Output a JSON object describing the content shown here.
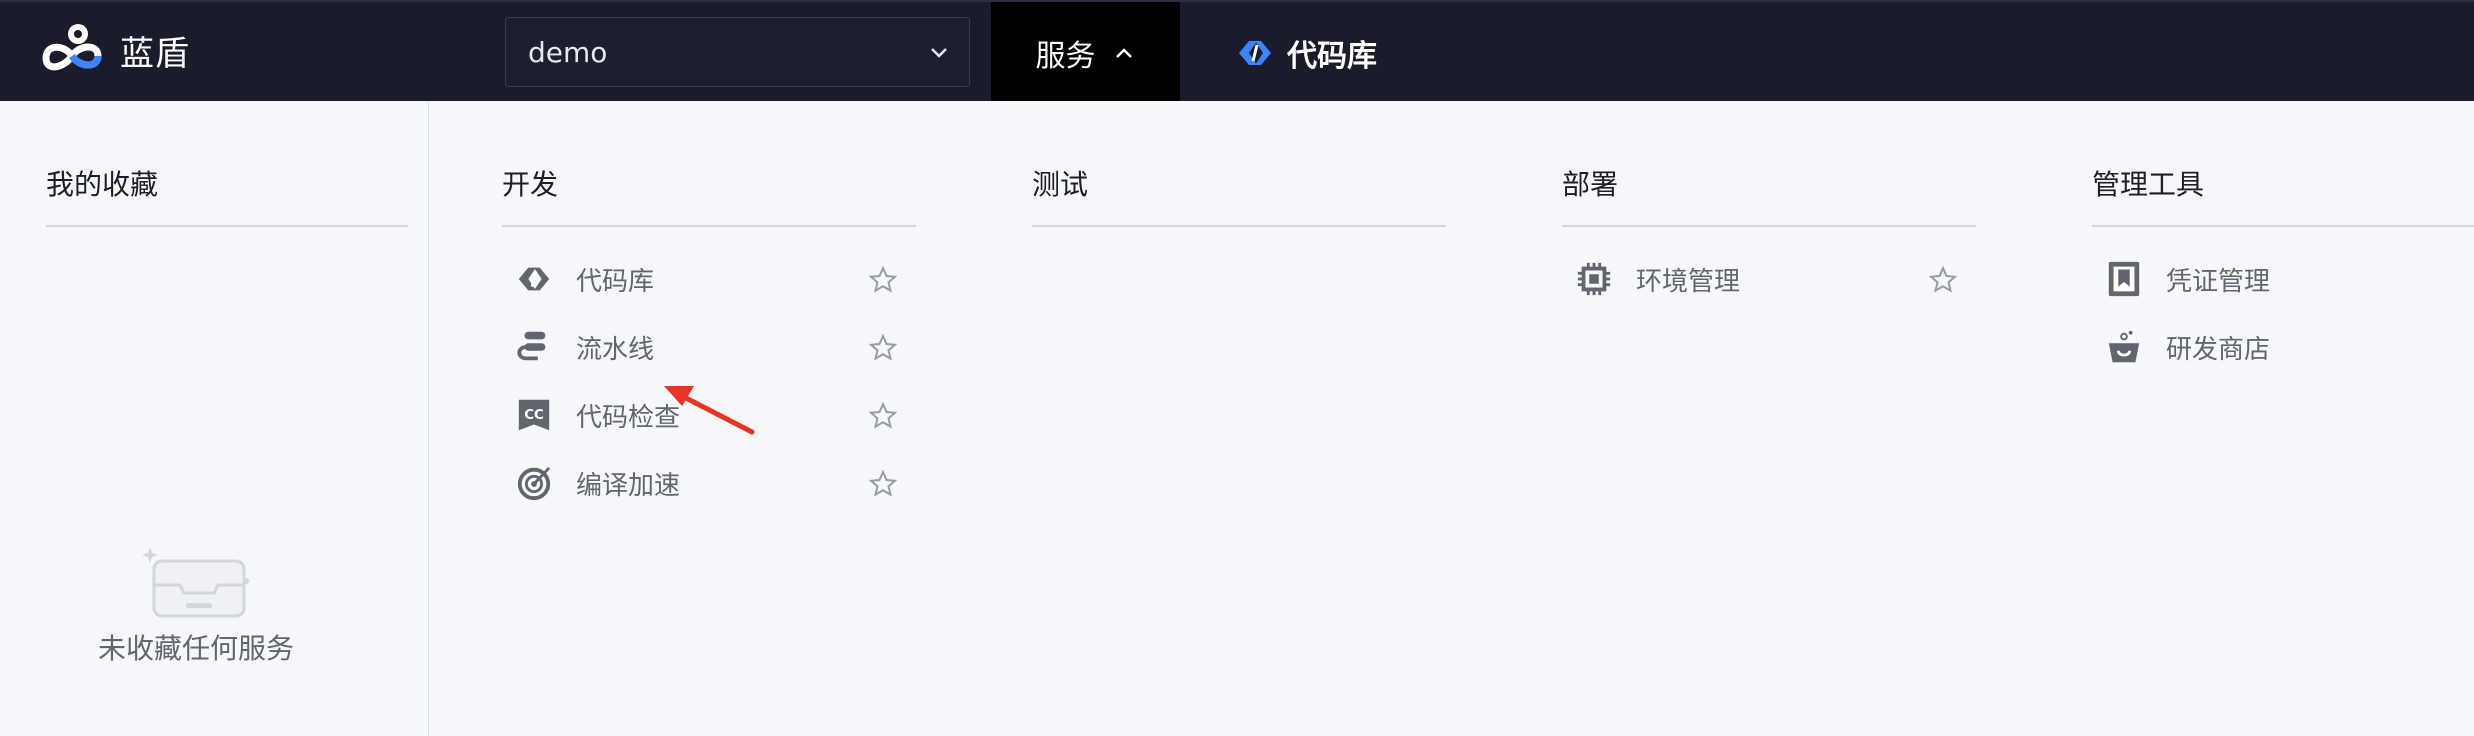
{
  "brand": {
    "name": "蓝盾"
  },
  "project": {
    "value": "demo"
  },
  "nav": {
    "services_label": "服务",
    "current_service": "代码库"
  },
  "favorites": {
    "title": "我的收藏",
    "empty_text": "未收藏任何服务"
  },
  "groups": {
    "dev": {
      "title": "开发",
      "items": [
        {
          "label": "代码库",
          "icon": "code-repo-icon"
        },
        {
          "label": "流水线",
          "icon": "pipeline-icon"
        },
        {
          "label": "代码检查",
          "icon": "code-check-icon"
        },
        {
          "label": "编译加速",
          "icon": "compile-accel-icon"
        }
      ]
    },
    "test": {
      "title": "测试",
      "items": []
    },
    "deploy": {
      "title": "部署",
      "items": [
        {
          "label": "环境管理",
          "icon": "environment-icon"
        }
      ]
    },
    "admin": {
      "title": "管理工具",
      "items": [
        {
          "label": "凭证管理",
          "icon": "credential-icon"
        },
        {
          "label": "研发商店",
          "icon": "store-icon"
        }
      ]
    }
  },
  "colors": {
    "topbar": "#1a1b2b",
    "active_tab": "#000000",
    "accent_blue": "#3a84ff",
    "annotation_red": "#ea3323"
  }
}
